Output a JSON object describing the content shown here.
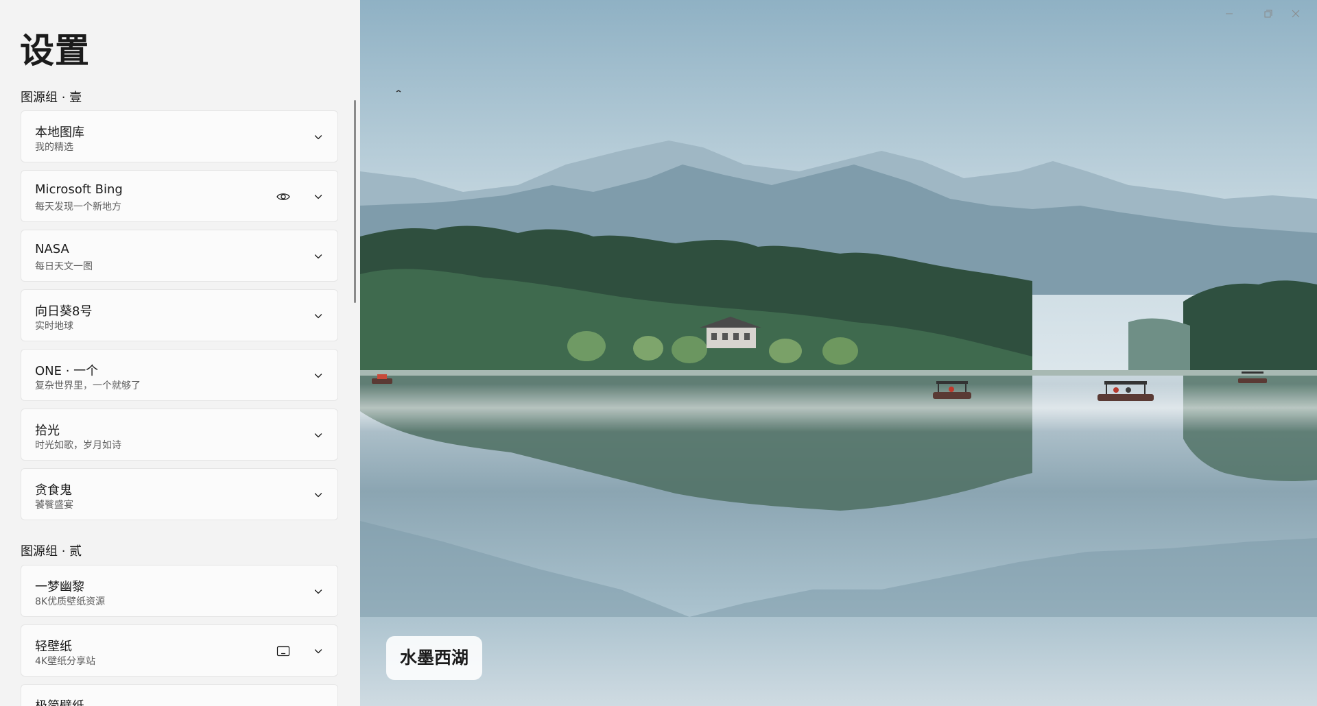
{
  "settings": {
    "title": "设置",
    "groups": [
      {
        "title": "图源组 · 壹",
        "items": [
          {
            "title": "本地图库",
            "subtitle": "我的精选"
          },
          {
            "title": "Microsoft Bing",
            "subtitle": "每天发现一个新地方",
            "icon": "eye-icon"
          },
          {
            "title": "NASA",
            "subtitle": "每日天文一图"
          },
          {
            "title": "向日葵8号",
            "subtitle": "实时地球"
          },
          {
            "title": "ONE · 一个",
            "subtitle": "复杂世界里，一个就够了"
          },
          {
            "title": "拾光",
            "subtitle": "时光如歌，岁月如诗"
          },
          {
            "title": "贪食鬼",
            "subtitle": "饕餮盛宴"
          }
        ]
      },
      {
        "title": "图源组 · 贰",
        "items": [
          {
            "title": "一梦幽黎",
            "subtitle": "8K优质壁纸资源"
          },
          {
            "title": "轻壁纸",
            "subtitle": "4K壁纸分享站",
            "icon": "monitor-icon"
          },
          {
            "title": "极简壁纸",
            "subtitle": ""
          }
        ]
      }
    ]
  },
  "wallpaper": {
    "caption": "水墨西湖"
  },
  "window_controls": [
    "minimize-icon",
    "restore-icon",
    "close-icon"
  ],
  "colors": {
    "panel_bg": "#f3f3f3",
    "card_bg": "#fbfbfb",
    "card_border": "#e5e5e5",
    "text_primary": "#1b1b1b",
    "text_secondary": "#5d5d5d"
  }
}
